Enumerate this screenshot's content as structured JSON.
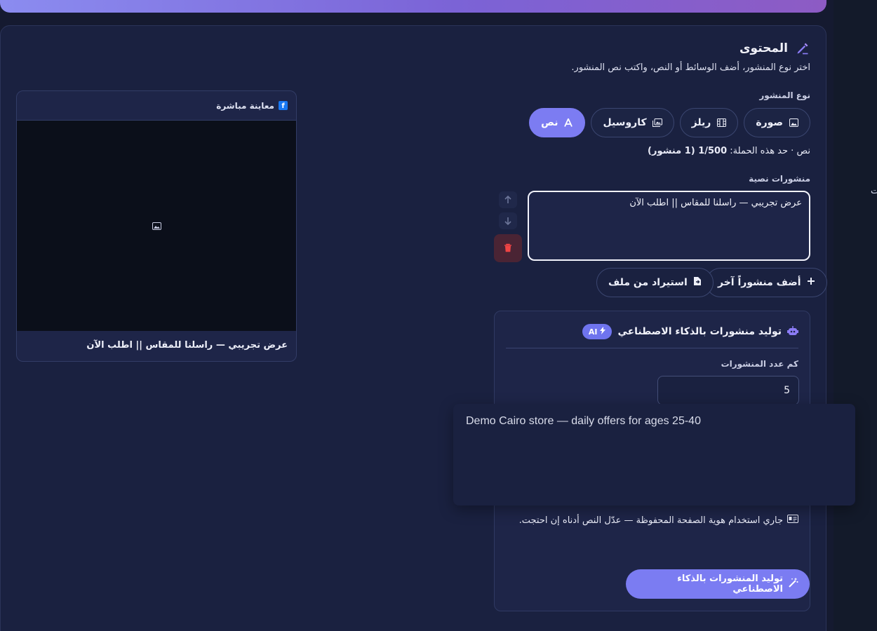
{
  "content": {
    "title": "المحتوى",
    "subtitle": "اختر نوع المنشور، أضف الوسائط أو النص، واكتب نص المنشور.",
    "post_type_label": "نوع المنشور",
    "post_types": [
      {
        "label": "صورة",
        "icon": "image-icon"
      },
      {
        "label": "ريلز",
        "icon": "film-icon"
      },
      {
        "label": "كاروسيل",
        "icon": "images-icon"
      },
      {
        "label": "نص",
        "icon": "text-icon",
        "active": true
      }
    ],
    "limit_prefix": "نص · حد هذه الحملة:",
    "limit_value": "1/500 (1 منشور)",
    "text_posts_label": "منشورات نصية",
    "text_post_value": "عرض تجريبي — راسلنا للمقاس || اطلب الآن",
    "add_post_label": "أضف منشوراً آخر",
    "import_label": "استيراد من ملف"
  },
  "ai": {
    "title": "توليد منشورات بالذكاء الاصطناعي",
    "badge": "AI",
    "count_label": "كم عدد المنشورات",
    "count_value": "5",
    "brand_note": "جاري استخدام هوية الصفحة المحفوظة — عدّل النص أدناه إن احتجت.",
    "generate_label": "توليد المنشورات بالذكاء الاصطناعي"
  },
  "tooltip": {
    "text": "Demo Cairo store — daily offers for ages 25-40"
  },
  "preview": {
    "title": "معاينة مباشرة",
    "caption": "عرض تجريبي — راسلنا للمقاس || اطلب الآن"
  },
  "rail": {
    "glyph": "ت"
  },
  "colors": {
    "accent": "#7c7cf2",
    "background": "#151a30",
    "card": "#1a2140",
    "danger": "#ef4444",
    "facebook": "#1877f2"
  }
}
